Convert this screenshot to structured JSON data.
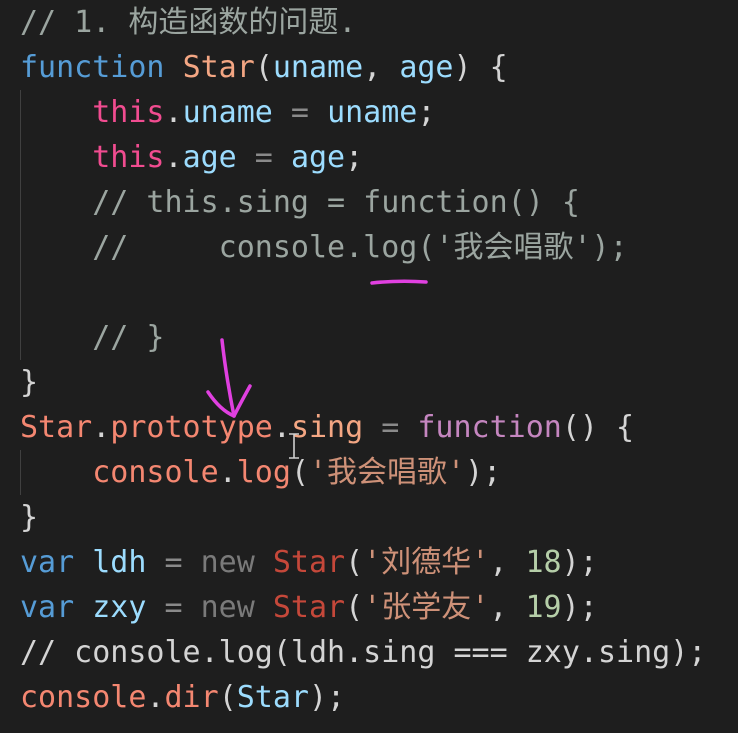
{
  "code": {
    "lines": [
      [
        {
          "t": "// 1. 构造函数的问题.",
          "c": "tk-comment2"
        }
      ],
      [
        {
          "t": "function ",
          "c": "tk-kw"
        },
        {
          "t": "Star",
          "c": "tk-peach"
        },
        {
          "t": "(",
          "c": "tk-punct"
        },
        {
          "t": "uname",
          "c": "tk-param"
        },
        {
          "t": ", ",
          "c": "tk-punct"
        },
        {
          "t": "age",
          "c": "tk-param"
        },
        {
          "t": ") {",
          "c": "tk-punct"
        }
      ],
      [
        {
          "t": "    "
        },
        {
          "t": "this",
          "c": "tk-this"
        },
        {
          "t": ".",
          "c": "tk-punct"
        },
        {
          "t": "uname",
          "c": "tk-prop"
        },
        {
          "t": " = ",
          "c": "tk-op"
        },
        {
          "t": "uname",
          "c": "tk-param"
        },
        {
          "t": ";",
          "c": "tk-punct"
        }
      ],
      [
        {
          "t": "    "
        },
        {
          "t": "this",
          "c": "tk-this"
        },
        {
          "t": ".",
          "c": "tk-punct"
        },
        {
          "t": "age",
          "c": "tk-prop"
        },
        {
          "t": " = ",
          "c": "tk-op"
        },
        {
          "t": "age",
          "c": "tk-param"
        },
        {
          "t": ";",
          "c": "tk-punct"
        }
      ],
      [
        {
          "t": "    "
        },
        {
          "t": "// this.sing = function() {",
          "c": "tk-comment2"
        }
      ],
      [
        {
          "t": "    "
        },
        {
          "t": "//     console.log('我会唱歌');",
          "c": "tk-comment2"
        }
      ],
      [
        {
          "t": ""
        }
      ],
      [
        {
          "t": "    "
        },
        {
          "t": "// }",
          "c": "tk-comment2"
        }
      ],
      [
        {
          "t": "}",
          "c": "tk-punct"
        }
      ],
      [
        {
          "t": "Star",
          "c": "tk-class"
        },
        {
          "t": ".",
          "c": "tk-punct"
        },
        {
          "t": "prototype",
          "c": "tk-class"
        },
        {
          "t": ".",
          "c": "tk-punct"
        },
        {
          "t": "sing",
          "c": "tk-peach"
        },
        {
          "t": " = ",
          "c": "tk-op"
        },
        {
          "t": "function",
          "c": "tk-keyword2"
        },
        {
          "t": "() {",
          "c": "tk-punct"
        }
      ],
      [
        {
          "t": "    "
        },
        {
          "t": "console",
          "c": "tk-class"
        },
        {
          "t": ".",
          "c": "tk-punct"
        },
        {
          "t": "log",
          "c": "tk-class"
        },
        {
          "t": "(",
          "c": "tk-punct"
        },
        {
          "t": "'我会唱歌'",
          "c": "tk-str"
        },
        {
          "t": ");",
          "c": "tk-punct"
        }
      ],
      [
        {
          "t": "}",
          "c": "tk-punct"
        }
      ],
      [
        {
          "t": "var ",
          "c": "tk-kw"
        },
        {
          "t": "ldh",
          "c": "tk-var"
        },
        {
          "t": " = ",
          "c": "tk-op"
        },
        {
          "t": "new ",
          "c": "tk-new"
        },
        {
          "t": "Star",
          "c": "tk-dimclass"
        },
        {
          "t": "(",
          "c": "tk-punct"
        },
        {
          "t": "'刘德华'",
          "c": "tk-str"
        },
        {
          "t": ", ",
          "c": "tk-punct"
        },
        {
          "t": "18",
          "c": "tk-num"
        },
        {
          "t": ");",
          "c": "tk-punct"
        }
      ],
      [
        {
          "t": "var ",
          "c": "tk-kw"
        },
        {
          "t": "zxy",
          "c": "tk-var"
        },
        {
          "t": " = ",
          "c": "tk-op"
        },
        {
          "t": "new ",
          "c": "tk-new"
        },
        {
          "t": "Star",
          "c": "tk-dimclass"
        },
        {
          "t": "(",
          "c": "tk-punct"
        },
        {
          "t": "'张学友'",
          "c": "tk-str"
        },
        {
          "t": ", ",
          "c": "tk-punct"
        },
        {
          "t": "19",
          "c": "tk-num"
        },
        {
          "t": ");",
          "c": "tk-punct"
        }
      ],
      [
        {
          "t": "// console.log(ldh.sing === zxy.sing);",
          "c": "tk-gray"
        }
      ],
      [
        {
          "t": "console",
          "c": "tk-class"
        },
        {
          "t": ".",
          "c": "tk-punct"
        },
        {
          "t": "dir",
          "c": "tk-class"
        },
        {
          "t": "(",
          "c": "tk-punct"
        },
        {
          "t": "Star",
          "c": "tk-param"
        },
        {
          "t": ");",
          "c": "tk-punct"
        }
      ]
    ]
  },
  "colors": {
    "background": "#1e1e1e",
    "annotation": "#e040e0"
  }
}
